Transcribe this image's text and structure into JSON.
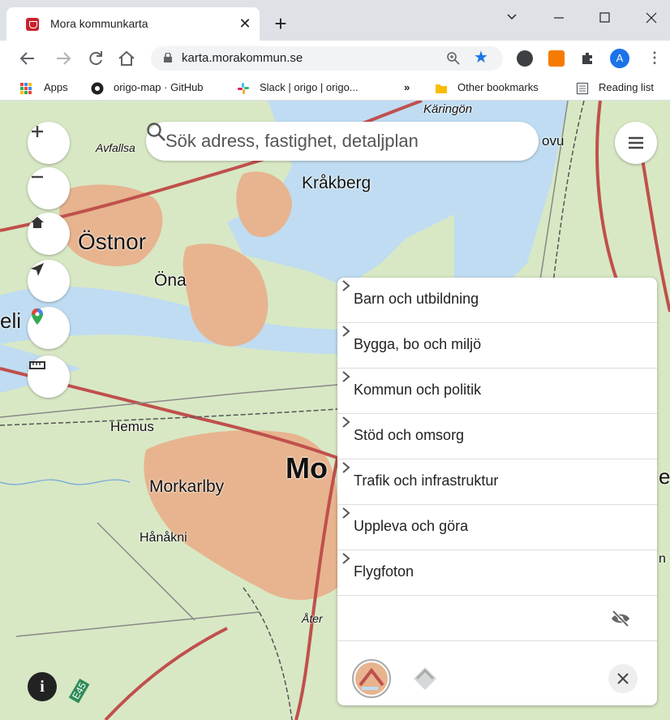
{
  "browser": {
    "tab_title": "Mora kommunkarta",
    "tab_close": "✕",
    "new_tab": "+",
    "url": "karta.morakommun.se",
    "avatar_letter": "A",
    "bookmarks": [
      "Apps",
      "origo-map · GitHub",
      "Slack | origo | origo...",
      "»",
      "Other bookmarks",
      "Reading list"
    ]
  },
  "map": {
    "search_placeholder": "Sök adress, fastighet, detaljplan",
    "place_labels": [
      "Käringön",
      "Avfallsa",
      "Kråkberg",
      "Östnor",
      "Öna",
      "eli",
      "Hemus",
      "Morkarlby",
      "Mo",
      "Hånåkni",
      "Åter",
      "ovu",
      "et",
      "n",
      "E45"
    ],
    "controls": [
      "zoom-in",
      "zoom-out",
      "home",
      "my-location",
      "google-maps",
      "measure"
    ],
    "info_label": "i"
  },
  "panel": {
    "items": [
      {
        "label": "Barn och utbildning"
      },
      {
        "label": "Bygga, bo och miljö"
      },
      {
        "label": "Kommun och politik"
      },
      {
        "label": "Stöd och omsorg"
      },
      {
        "label": "Trafik och infrastruktur"
      },
      {
        "label": "Uppleva och göra"
      },
      {
        "label": "Flygfoton"
      }
    ]
  },
  "colors": {
    "water": "#bfdcf2",
    "land": "#d8e8c4",
    "urban": "#e7b48f",
    "road": "#c0504d",
    "accent": "#1a73e8"
  }
}
